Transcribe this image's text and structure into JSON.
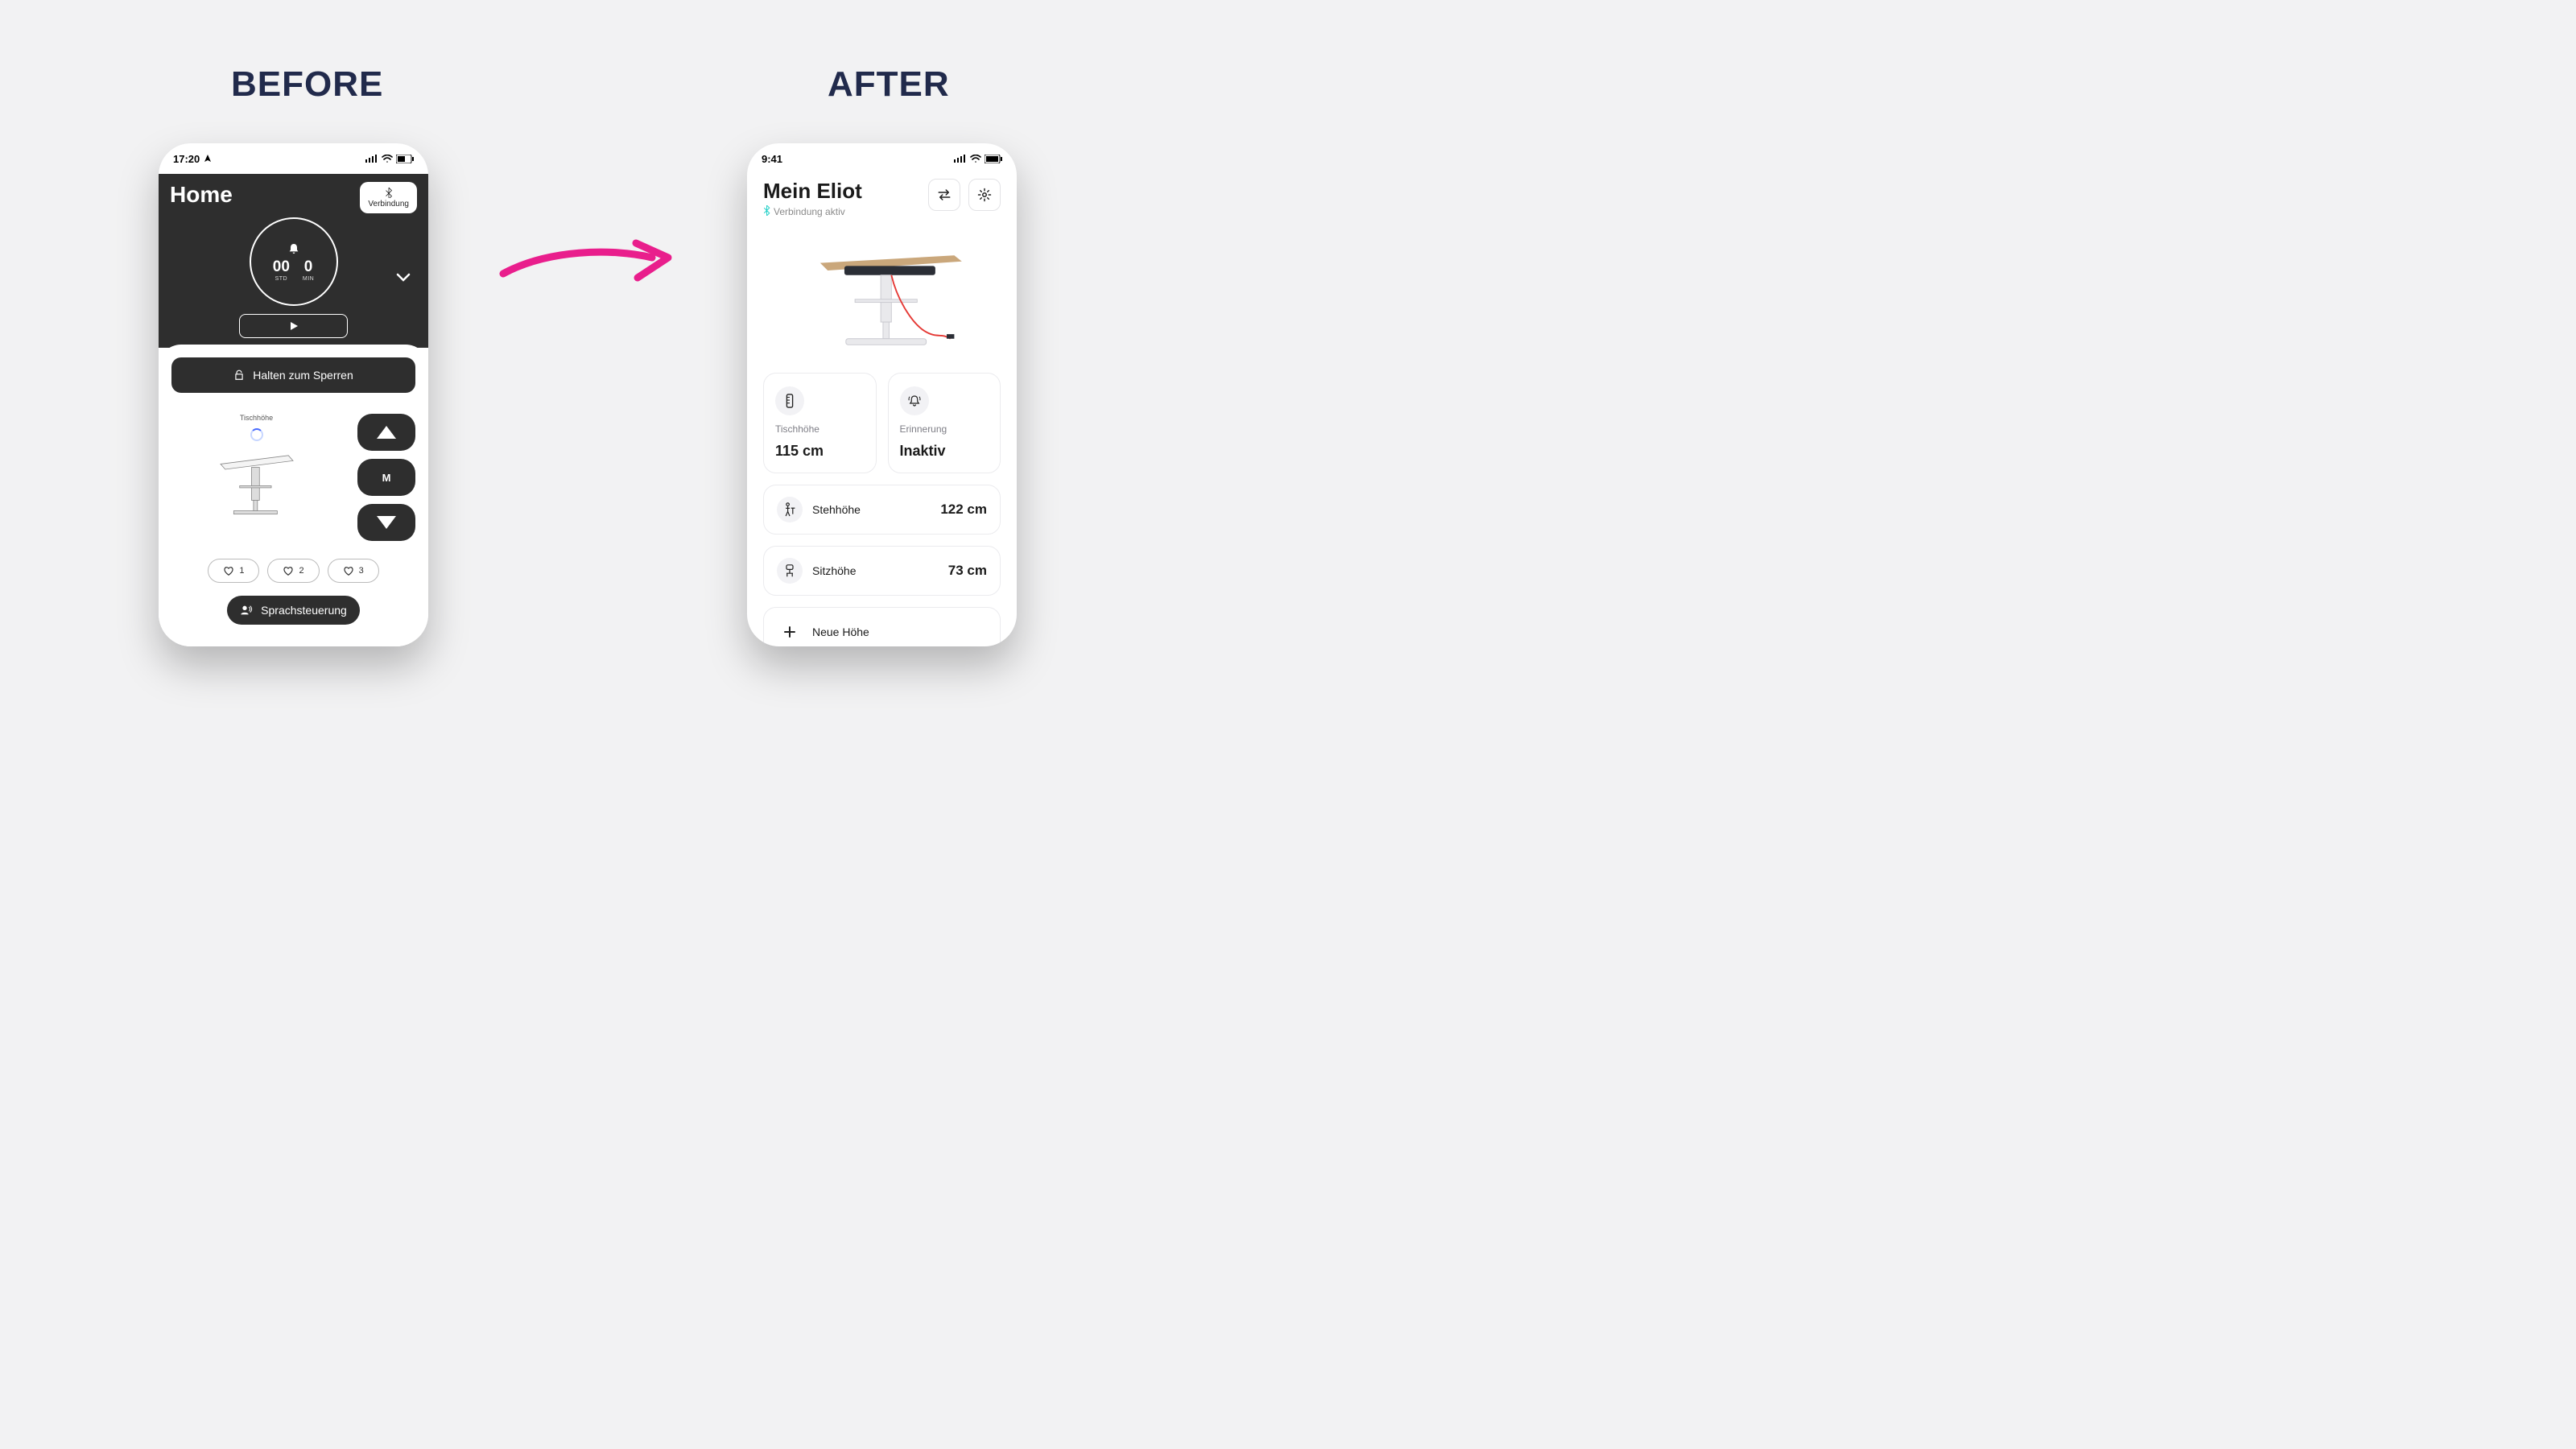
{
  "labels": {
    "before": "BEFORE",
    "after": "AFTER"
  },
  "before": {
    "status_time": "17:20",
    "title": "Home",
    "connection_button": "Verbindung",
    "timer": {
      "hours": "00",
      "hours_label": "STD",
      "mins": "0",
      "mins_label": "MIN"
    },
    "lock_label": "Halten zum Sperren",
    "height_label": "Tischhöhe",
    "memory_button": "M",
    "favorites": [
      "1",
      "2",
      "3"
    ],
    "voice_label": "Sprachsteuerung"
  },
  "after": {
    "status_time": "9:41",
    "title": "Mein Eliot",
    "connection_status": "Verbindung aktiv",
    "cards": {
      "height": {
        "label": "Tischhöhe",
        "value": "115 cm"
      },
      "reminder": {
        "label": "Erinnerung",
        "value": "Inaktiv"
      }
    },
    "rows": {
      "stand": {
        "label": "Stehhöhe",
        "value": "122 cm"
      },
      "sit": {
        "label": "Sitzhöhe",
        "value": "73 cm"
      },
      "new": {
        "label": "Neue Höhe"
      }
    }
  }
}
